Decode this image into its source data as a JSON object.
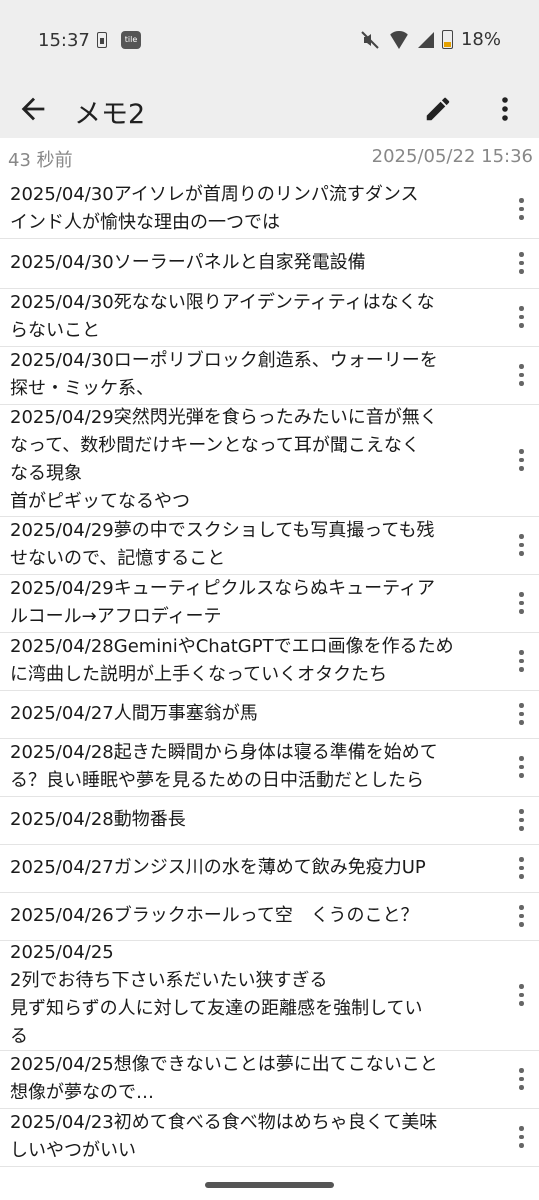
{
  "status": {
    "time": "15:37",
    "tile_label": "tile",
    "battery": "18%"
  },
  "appbar": {
    "title": "メモ2",
    "back_icon": "arrow-back-icon",
    "edit_icon": "pencil-icon",
    "more_icon": "more-vert-icon"
  },
  "meta": {
    "elapsed": "43 秒前",
    "datetime": "2025/05/22 15:36"
  },
  "items": [
    {
      "text": "2025/04/30アイソレが首周りのリンパ流すダンス\nインド人が愉快な理由の一つでは"
    },
    {
      "text": "2025/04/30ソーラーパネルと自家発電設備"
    },
    {
      "text": "2025/04/30死なない限りアイデンティティはなくな\nらないこと"
    },
    {
      "text": "2025/04/30ローポリブロック創造系、ウォーリーを\n探せ・ミッケ系、"
    },
    {
      "text": "2025/04/29突然閃光弾を食らったみたいに音が無く\nなって、数秒間だけキーンとなって耳が聞こえなく\nなる現象\n首がピギッてなるやつ"
    },
    {
      "text": "2025/04/29夢の中でスクショしても写真撮っても残\nせないので、記憶すること"
    },
    {
      "text": "2025/04/29キューティピクルスならぬキューティア\nルコール→アフロディーテ"
    },
    {
      "text": "2025/04/28GeminiやChatGPTでエロ画像を作るため\nに湾曲した説明が上手くなっていくオタクたち"
    },
    {
      "text": "2025/04/27人間万事塞翁が馬"
    },
    {
      "text": "2025/04/28起きた瞬間から身体は寝る準備を始めて\nる？良い睡眠や夢を見るための日中活動だとしたら"
    },
    {
      "text": "2025/04/28動物番長"
    },
    {
      "text": "2025/04/27ガンジス川の水を薄めて飲み免疫力UP"
    },
    {
      "text": "2025/04/26ブラックホールって空　くうのこと？"
    },
    {
      "text": "2025/04/25\n2列でお待ち下さい系だいたい狭すぎる\n見ず知らずの人に対して友達の距離感を強制してい\nる"
    },
    {
      "text": "2025/04/25想像できないことは夢に出てこないこと\n想像が夢なので…"
    },
    {
      "text": "2025/04/23初めて食べる食べ物はめちゃ良くて美味\nしいやつがいい"
    }
  ]
}
